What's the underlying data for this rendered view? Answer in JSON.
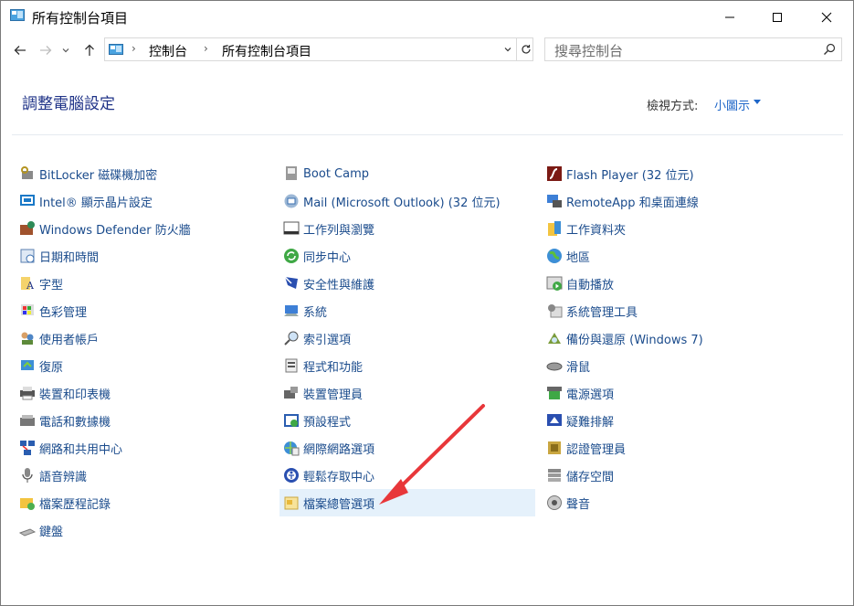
{
  "window": {
    "title": "所有控制台項目",
    "minimize_glyph": "—",
    "maximize_glyph": "☐",
    "close_glyph": "✕"
  },
  "address_bar": {
    "breadcrumbs": [
      "控制台",
      "所有控制台項目"
    ],
    "separator": "›"
  },
  "search": {
    "placeholder": "搜尋控制台"
  },
  "header": {
    "title": "調整電腦設定",
    "view_by_label": "檢視方式:",
    "view_by_value": "小圖示"
  },
  "columns": [
    {
      "items": [
        {
          "label": "BitLocker 磁碟機加密",
          "icon": "bitlocker-icon"
        },
        {
          "label": "Intel® 顯示晶片設定",
          "icon": "intel-graphics-icon"
        },
        {
          "label": "Windows Defender 防火牆",
          "icon": "firewall-icon"
        },
        {
          "label": "日期和時間",
          "icon": "date-time-icon"
        },
        {
          "label": "字型",
          "icon": "fonts-icon"
        },
        {
          "label": "色彩管理",
          "icon": "color-management-icon"
        },
        {
          "label": "使用者帳戶",
          "icon": "user-accounts-icon"
        },
        {
          "label": "復原",
          "icon": "recovery-icon"
        },
        {
          "label": "裝置和印表機",
          "icon": "devices-printers-icon"
        },
        {
          "label": "電話和數據機",
          "icon": "phone-modem-icon"
        },
        {
          "label": "網路和共用中心",
          "icon": "network-sharing-icon"
        },
        {
          "label": "語音辨識",
          "icon": "speech-recognition-icon"
        },
        {
          "label": "檔案歷程記錄",
          "icon": "file-history-icon"
        },
        {
          "label": "鍵盤",
          "icon": "keyboard-icon"
        }
      ]
    },
    {
      "items": [
        {
          "label": "Boot Camp",
          "icon": "boot-camp-icon"
        },
        {
          "label": "Mail (Microsoft Outlook) (32 位元)",
          "icon": "mail-icon"
        },
        {
          "label": "工作列與瀏覽",
          "icon": "taskbar-icon"
        },
        {
          "label": "同步中心",
          "icon": "sync-center-icon"
        },
        {
          "label": "安全性與維護",
          "icon": "security-maintenance-icon"
        },
        {
          "label": "系統",
          "icon": "system-icon"
        },
        {
          "label": "索引選項",
          "icon": "indexing-options-icon"
        },
        {
          "label": "程式和功能",
          "icon": "programs-features-icon"
        },
        {
          "label": "裝置管理員",
          "icon": "device-manager-icon"
        },
        {
          "label": "預設程式",
          "icon": "default-programs-icon"
        },
        {
          "label": "網際網路選項",
          "icon": "internet-options-icon"
        },
        {
          "label": "輕鬆存取中心",
          "icon": "ease-of-access-icon"
        },
        {
          "label": "檔案總管選項",
          "icon": "file-explorer-options-icon",
          "highlighted": true
        }
      ]
    },
    {
      "items": [
        {
          "label": "Flash Player (32 位元)",
          "icon": "flash-player-icon"
        },
        {
          "label": "RemoteApp 和桌面連線",
          "icon": "remoteapp-icon"
        },
        {
          "label": "工作資料夾",
          "icon": "work-folders-icon"
        },
        {
          "label": "地區",
          "icon": "region-icon"
        },
        {
          "label": "自動播放",
          "icon": "autoplay-icon"
        },
        {
          "label": "系統管理工具",
          "icon": "admin-tools-icon"
        },
        {
          "label": "備份與還原 (Windows 7)",
          "icon": "backup-restore-icon"
        },
        {
          "label": "滑鼠",
          "icon": "mouse-icon"
        },
        {
          "label": "電源選項",
          "icon": "power-options-icon"
        },
        {
          "label": "疑難排解",
          "icon": "troubleshooting-icon"
        },
        {
          "label": "認證管理員",
          "icon": "credential-manager-icon"
        },
        {
          "label": "儲存空間",
          "icon": "storage-spaces-icon"
        },
        {
          "label": "聲音",
          "icon": "sound-icon"
        }
      ]
    }
  ],
  "annotation": {
    "arrow_color": "#e8373a"
  },
  "colors": {
    "link": "#1a4b8c",
    "heading": "#1e3287",
    "accent": "#1e66c8",
    "highlight": "#e5f1fb"
  }
}
